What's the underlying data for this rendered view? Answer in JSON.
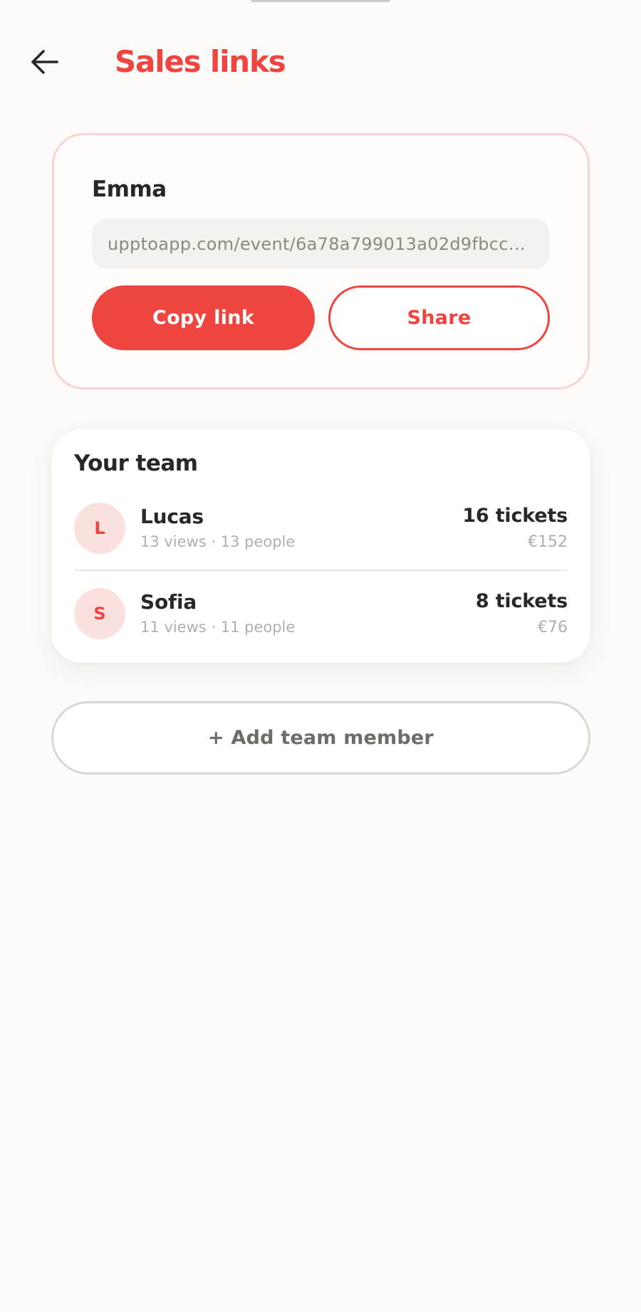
{
  "header": {
    "title": "Sales links",
    "back_icon": "arrow-left-icon"
  },
  "personal_link": {
    "owner_name": "Emma",
    "url": "upptoapp.com/event/6a78a799013a02d9fbccd…",
    "copy_label": "Copy link",
    "share_label": "Share"
  },
  "team": {
    "title": "Your team",
    "members": [
      {
        "initial": "L",
        "name": "Lucas",
        "stats": "13 views · 13 people",
        "tickets": "16 tickets",
        "revenue": "€152"
      },
      {
        "initial": "S",
        "name": "Sofia",
        "stats": "11 views · 11 people",
        "tickets": "8 tickets",
        "revenue": "€76"
      }
    ],
    "add_label": "+ Add team member"
  },
  "colors": {
    "accent": "#ee4541",
    "avatar_bg": "#fbe1dd",
    "card_border": "#f8d5d2",
    "background": "#fdfbf9"
  }
}
